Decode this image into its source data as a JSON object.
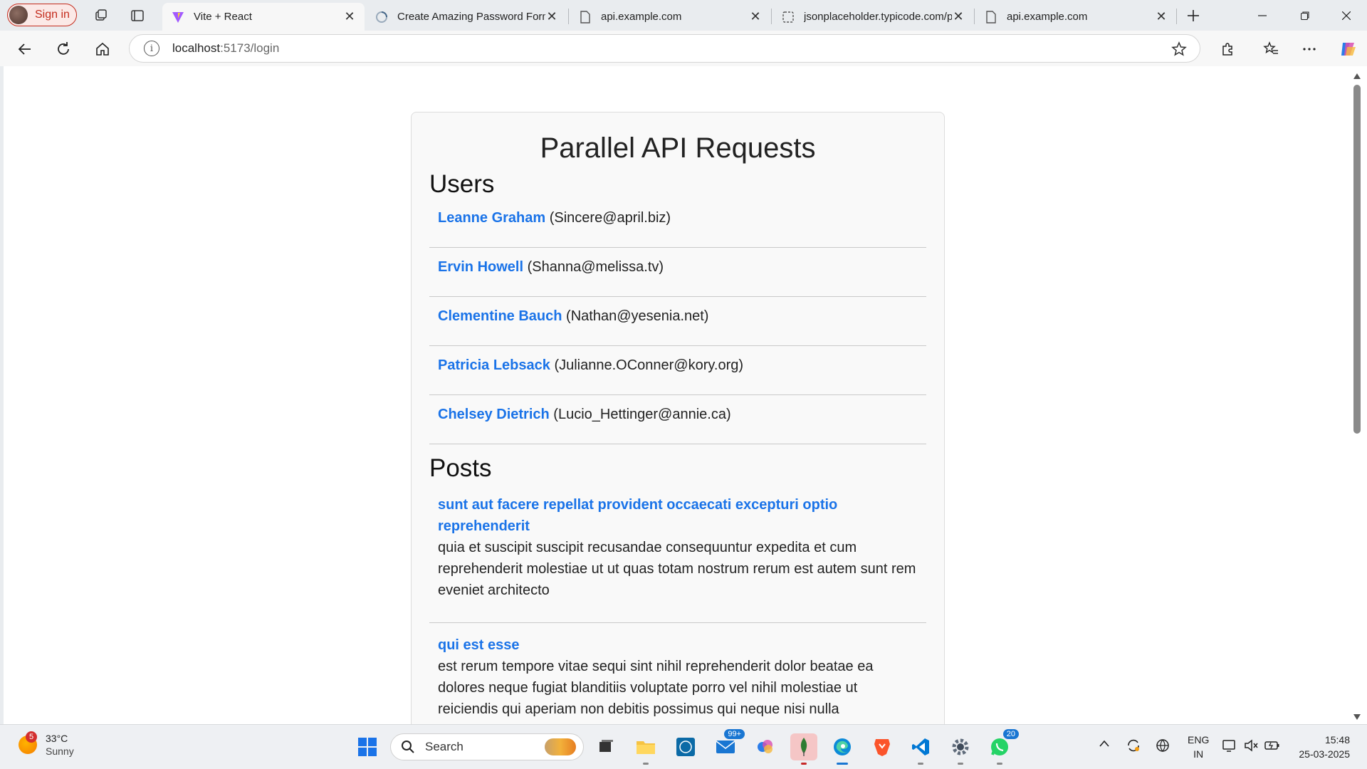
{
  "browser": {
    "profile_label": "Sign in",
    "tabs": [
      {
        "title": "Vite + React",
        "active": true,
        "icon": "vite-icon"
      },
      {
        "title": "Create Amazing Password Form",
        "active": false,
        "icon": "loading-icon"
      },
      {
        "title": "api.example.com",
        "active": false,
        "icon": "page-icon"
      },
      {
        "title": "jsonplaceholder.typicode.com/p",
        "active": false,
        "icon": "page-icon"
      },
      {
        "title": "api.example.com",
        "active": false,
        "icon": "page-icon"
      }
    ],
    "address": {
      "host": "localhost",
      "path": ":5173/login"
    },
    "info_glyph": "i"
  },
  "page": {
    "title": "Parallel API Requests",
    "users_heading": "Users",
    "users": [
      {
        "name": "Leanne Graham",
        "email": "(Sincere@april.biz)"
      },
      {
        "name": "Ervin Howell",
        "email": "(Shanna@melissa.tv)"
      },
      {
        "name": "Clementine Bauch",
        "email": "(Nathan@yesenia.net)"
      },
      {
        "name": "Patricia Lebsack",
        "email": "(Julianne.OConner@kory.org)"
      },
      {
        "name": "Chelsey Dietrich",
        "email": "(Lucio_Hettinger@annie.ca)"
      }
    ],
    "posts_heading": "Posts",
    "posts": [
      {
        "title": "sunt aut facere repellat provident occaecati excepturi optio reprehenderit",
        "body": "quia et suscipit suscipit recusandae consequuntur expedita et cum reprehenderit molestiae ut ut quas totam nostrum rerum est autem sunt rem eveniet architecto"
      },
      {
        "title": "qui est esse",
        "body": "est rerum tempore vitae sequi sint nihil reprehenderit dolor beatae ea dolores neque fugiat blanditiis voluptate porro vel nihil molestiae ut reiciendis qui aperiam non debitis possimus qui neque nisi nulla"
      }
    ]
  },
  "taskbar": {
    "weather": {
      "temp": "33°C",
      "condition": "Sunny",
      "alert_count": "5"
    },
    "search_label": "Search",
    "mail_badge": "99+",
    "whatsapp_badge": "20",
    "lang_top": "ENG",
    "lang_bottom": "IN",
    "time": "15:48",
    "date": "25-03-2025"
  },
  "colors": {
    "link": "#1a73e8",
    "accent_profile": "#c42b1c"
  }
}
